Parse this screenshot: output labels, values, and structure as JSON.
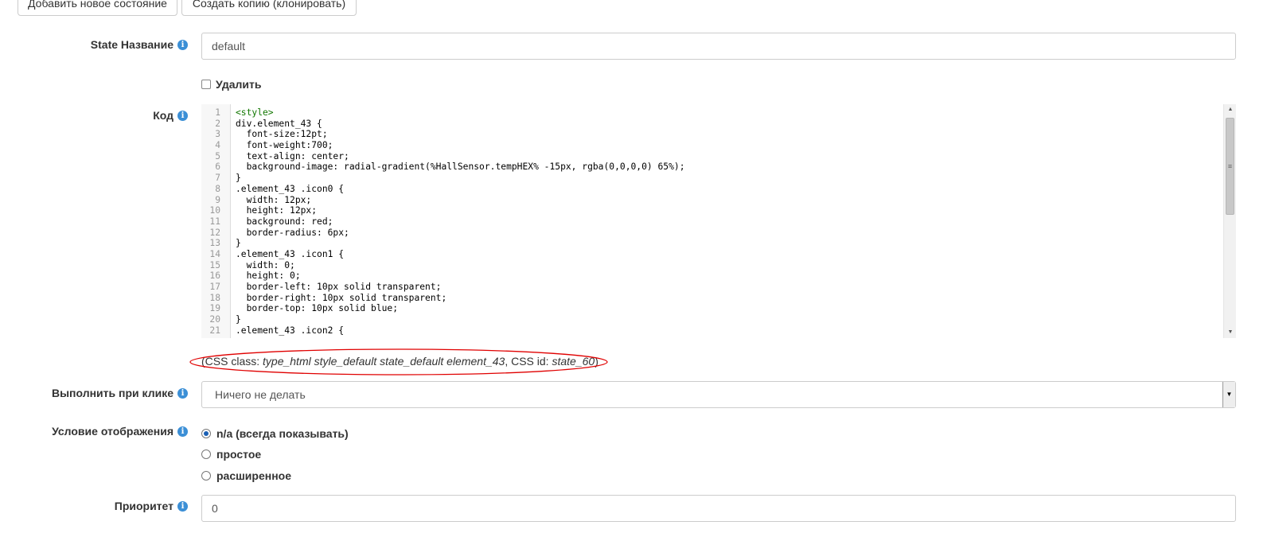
{
  "toolbar": {
    "add_state_label": "Добавить новое состояние",
    "clone_label": "Создать копию (клонировать)"
  },
  "form": {
    "state_name": {
      "label": "State Название",
      "value": "default"
    },
    "delete": {
      "label": "Удалить",
      "checked": false
    },
    "code": {
      "label": "Код",
      "lines": [
        "<style>",
        "div.element_43 {",
        "  font-size:12pt;",
        "  font-weight:700;",
        "  text-align: center;",
        "  background-image: radial-gradient(%HallSensor.tempHEX% -15px, rgba(0,0,0,0) 65%);",
        "}",
        ".element_43 .icon0 {",
        "  width: 12px;",
        "  height: 12px;",
        "  background: red;",
        "  border-radius: 6px;",
        "}",
        ".element_43 .icon1 {",
        "  width: 0;",
        "  height: 0;",
        "  border-left: 10px solid transparent;",
        "  border-right: 10px solid transparent;",
        "  border-top: 10px solid blue;",
        "}",
        ".element_43 .icon2 {"
      ]
    },
    "css_hint": {
      "prefix": "(CSS class: ",
      "classes": "type_html style_default state_default element_43",
      "mid": ", CSS id: ",
      "id": "state_60",
      "suffix": ")"
    },
    "on_click": {
      "label": "Выполнить при клике",
      "value": "Ничего не делать"
    },
    "display_condition": {
      "label": "Условие отображения",
      "options": [
        "n/a (всегда показывать)",
        "простое",
        "расширенное"
      ],
      "selected": 0
    },
    "priority": {
      "label": "Приоритет",
      "value": "0"
    }
  },
  "colors": {
    "info_icon": "#3b8fd6",
    "annotation_oval": "#e00000",
    "code_tag": "#117700"
  },
  "icons": [
    "info-icon",
    "scroll-up-icon",
    "scroll-down-icon",
    "dropdown-arrow-icon"
  ]
}
